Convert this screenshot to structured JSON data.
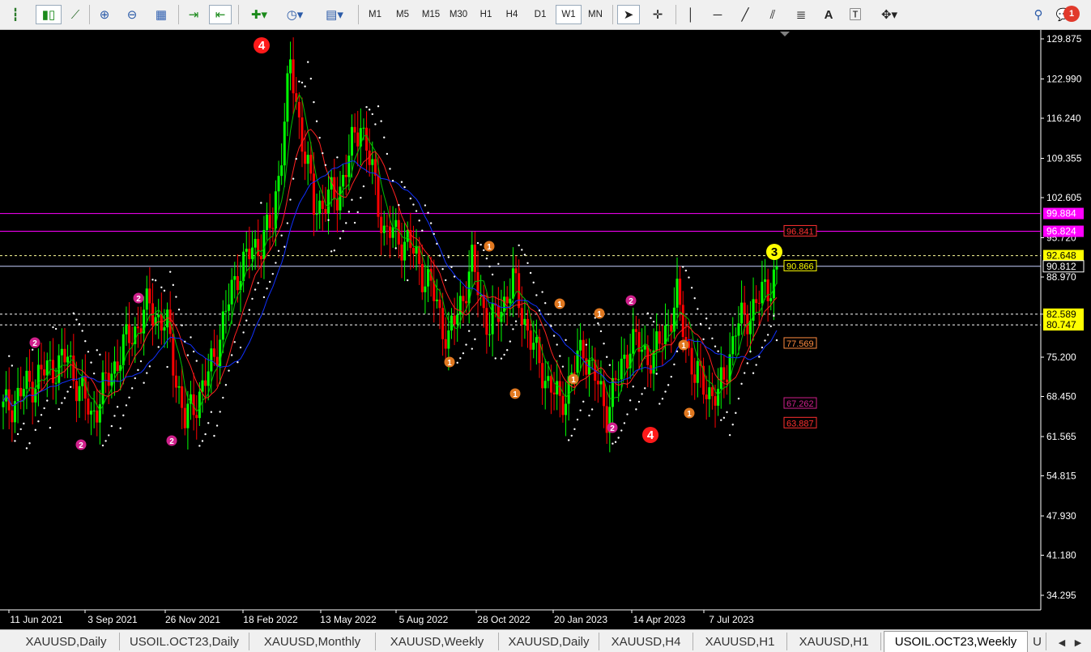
{
  "toolbar": {
    "timeframes": [
      "M1",
      "M5",
      "M15",
      "M30",
      "H1",
      "H4",
      "D1",
      "W1",
      "MN"
    ],
    "active_timeframe": "W1",
    "notification_count": "1",
    "icons": [
      "bar-chart-icon",
      "candlestick-icon",
      "line-chart-icon",
      "zoom-in-icon",
      "zoom-out-icon",
      "tile-windows-icon",
      "auto-scroll-icon",
      "chart-shift-icon",
      "new-chart-icon",
      "clock-icon",
      "template-icon",
      "cursor-icon",
      "crosshair-icon",
      "vertical-line-icon",
      "horizontal-line-icon",
      "trendline-icon",
      "channel-icon",
      "fibonacci-icon",
      "text-icon",
      "text-label-icon",
      "shapes-icon",
      "search-icon",
      "chat-icon"
    ]
  },
  "chart_data": {
    "type": "candlestick",
    "symbol": "USOIL.OCT23",
    "timeframe": "Weekly",
    "y_ticks": [
      129.875,
      122.99,
      116.24,
      109.355,
      102.605,
      95.72,
      88.97,
      82.589,
      75.2,
      68.45,
      61.565,
      54.815,
      47.93,
      41.18,
      34.295
    ],
    "x_labels": [
      "11 Jun 2021",
      "3 Sep 2021",
      "26 Nov 2021",
      "18 Feb 2022",
      "13 May 2022",
      "5 Aug 2022",
      "28 Oct 2022",
      "20 Jan 2023",
      "14 Apr 2023",
      "7 Jul 2023"
    ],
    "price_tags": [
      {
        "value": "99.884",
        "price": 99.884,
        "bg": "#ff00ff",
        "fg": "#ffffff"
      },
      {
        "value": "96.824",
        "price": 96.824,
        "bg": "#ff00ff",
        "fg": "#ffffff"
      },
      {
        "value": "92.648",
        "price": 92.648,
        "bg": "#ffff00",
        "fg": "#000000"
      },
      {
        "value": "90.812",
        "price": 90.812,
        "bg": "#000000",
        "fg": "#ffffff"
      },
      {
        "value": "82.589",
        "price": 82.589,
        "bg": "#ffff00",
        "fg": "#000000"
      },
      {
        "value": "80.747",
        "price": 80.747,
        "bg": "#ffff00",
        "fg": "#000000"
      }
    ],
    "level_labels": [
      {
        "value": "96.841",
        "price": 96.841,
        "color": "#ff3030"
      },
      {
        "value": "90.866",
        "price": 90.866,
        "color": "#ffff00"
      },
      {
        "value": "77.569",
        "price": 77.569,
        "color": "#ff8c40"
      },
      {
        "value": "67.262",
        "price": 67.262,
        "color": "#d0208c"
      },
      {
        "value": "63.887",
        "price": 63.887,
        "color": "#ff3030"
      }
    ],
    "wave_marks": [
      {
        "label": "4",
        "color": "#ff1a1a",
        "fg": "#ffffff",
        "big": true
      },
      {
        "label": "4",
        "color": "#ff1a1a",
        "fg": "#ffffff",
        "big": true
      },
      {
        "label": "3",
        "color": "#ffff00",
        "fg": "#000000",
        "big": true
      },
      {
        "label": "2",
        "color": "#d0208c",
        "fg": "#ffffff",
        "big": false
      },
      {
        "label": "1",
        "color": "#e07820",
        "fg": "#ffffff",
        "big": false
      }
    ],
    "colors": {
      "background": "#000000",
      "bull": "#00ff00",
      "bear": "#ff0000",
      "ma_fast": "#00c000",
      "ma_mid": "#ff2020",
      "ma_slow": "#1030ff",
      "sar": "#ffffff"
    }
  },
  "tabs": {
    "items": [
      "XAUUSD,Daily",
      "USOIL.OCT23,Daily",
      "XAUUSD,Monthly",
      "XAUUSD,Weekly",
      "XAUUSD,Daily",
      "XAUUSD,H4",
      "XAUUSD,H1",
      "XAUUSD,H1",
      "USOIL.OCT23,Weekly",
      "U"
    ],
    "active_index": 8
  }
}
